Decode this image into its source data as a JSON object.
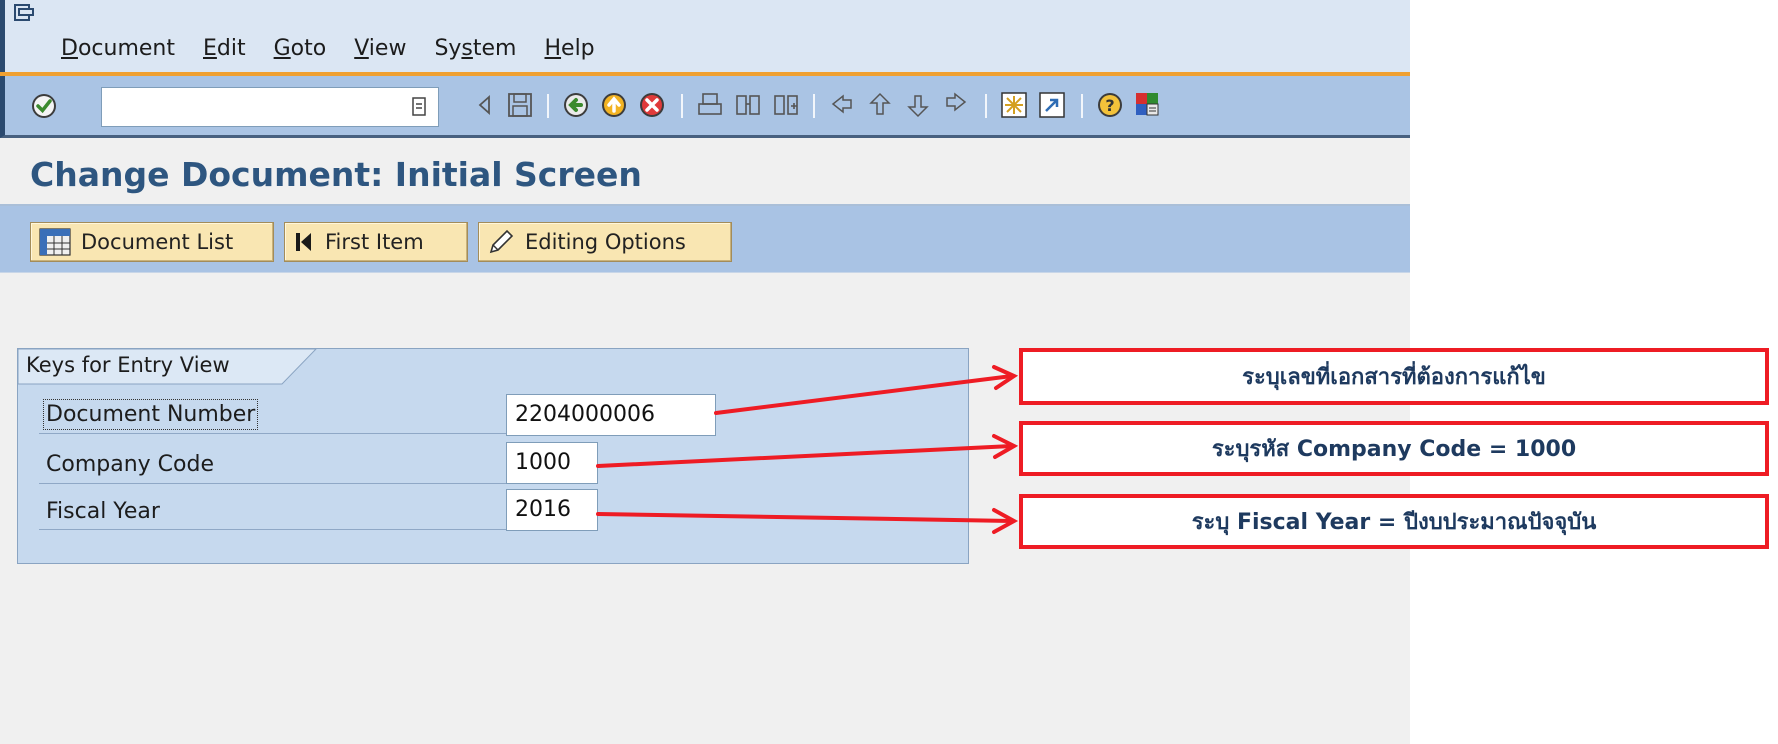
{
  "menu": {
    "items": [
      {
        "label_u": "D",
        "label_rest": "ocument"
      },
      {
        "label_u": "E",
        "label_rest": "dit"
      },
      {
        "label_u": "G",
        "label_rest": "oto"
      },
      {
        "label_u": "V",
        "label_rest": "iew"
      },
      {
        "label_pre": "Sy",
        "label_u": "s",
        "label_rest": "tem"
      },
      {
        "label_u": "H",
        "label_rest": "elp"
      }
    ]
  },
  "toolbar": {
    "command_field_value": "",
    "icons": [
      "enter-icon",
      "back-arrow-icon",
      "save-icon",
      "back-icon",
      "exit-icon",
      "cancel-icon",
      "print-icon",
      "find-icon",
      "find-next-icon",
      "first-page-icon",
      "previous-page-icon",
      "next-page-icon",
      "last-page-icon",
      "create-session-icon",
      "shortcut-icon",
      "help-icon",
      "customize-layout-icon"
    ]
  },
  "page": {
    "title": "Change Document: Initial Screen"
  },
  "app_toolbar": {
    "document_list": "Document List",
    "first_item": "First Item",
    "editing_options": "Editing Options"
  },
  "group": {
    "title": "Keys for Entry View",
    "fields": {
      "document_number": {
        "label": "Document Number",
        "value": "2204000006"
      },
      "company_code": {
        "label": "Company Code",
        "value": "1000"
      },
      "fiscal_year": {
        "label": "Fiscal Year",
        "value": "2016"
      }
    }
  },
  "annotations": {
    "callout1": "ระบุเลขที่เอกสารที่ต้องการแก้ไข",
    "callout2": "ระบุรหัส Company Code = 1000",
    "callout3": "ระบุ Fiscal Year = ปีงบประมาณปัจจุบัน",
    "color": "#ee1c24"
  },
  "colors": {
    "title": "#2e5680",
    "toolbar": "#aac4e4",
    "button": "#f9e6b2",
    "group": "#c6d9ee"
  }
}
